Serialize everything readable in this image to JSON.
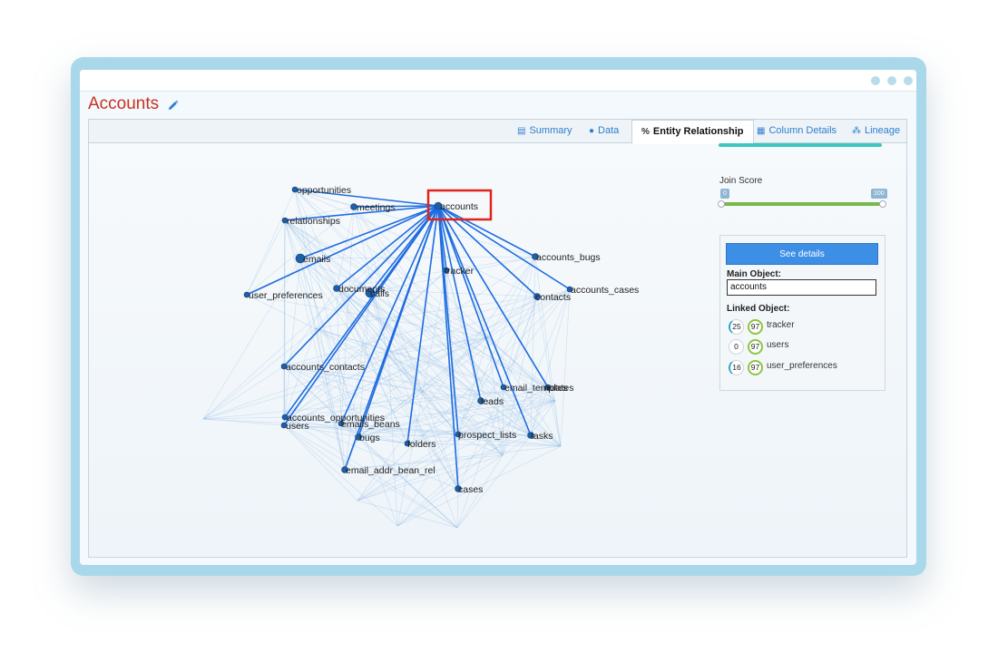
{
  "window": {
    "title": "Accounts"
  },
  "tabs": [
    {
      "label": "Summary",
      "icon": "document-icon"
    },
    {
      "label": "Data",
      "icon": "info-icon"
    },
    {
      "label": "Entity Relationship",
      "icon": "link-icon",
      "active": true
    },
    {
      "label": "Column Details",
      "icon": "table-icon"
    },
    {
      "label": "Lineage",
      "icon": "hierarchy-icon"
    }
  ],
  "graph": {
    "focus": "accounts",
    "nodes": [
      "accounts",
      "opportunities",
      "meetings",
      "relationships",
      "emails",
      "user_preferences",
      "documents",
      "calls",
      "tracker",
      "accounts_bugs",
      "accounts_cases",
      "contacts",
      "accounts_contacts",
      "email_templates",
      "notes",
      "leads",
      "accounts_opportunities",
      "users",
      "emails_beans",
      "bugs",
      "folders",
      "prospect_lists",
      "tasks",
      "email_addr_bean_rel",
      "cases"
    ]
  },
  "join_score": {
    "label": "Join Score",
    "min": "0",
    "max": "100"
  },
  "details": {
    "button_label": "See details",
    "main_object_label": "Main Object:",
    "main_object_value": "accounts",
    "linked_object_label": "Linked Object:",
    "linked": [
      {
        "score_a": "25",
        "score_b": "97",
        "name": "tracker"
      },
      {
        "score_a": "0",
        "score_b": "97",
        "name": "users"
      },
      {
        "score_a": "16",
        "score_b": "97",
        "name": "user_preferences"
      }
    ]
  },
  "colors": {
    "title": "#c8311f",
    "accent": "#2d7fd0",
    "node": "#1f5fa8",
    "edge": "#1e6ce0",
    "highlight": "#e0231b"
  }
}
